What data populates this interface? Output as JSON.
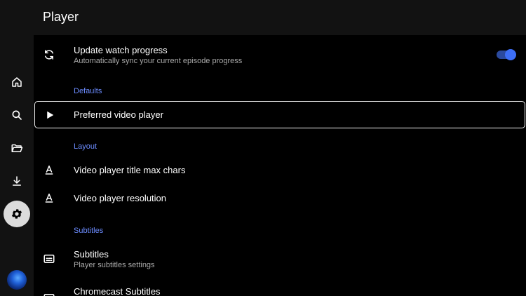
{
  "header": {
    "title": "Player"
  },
  "nav": [
    {
      "name": "home",
      "icon": "home-icon",
      "active": false
    },
    {
      "name": "search",
      "icon": "search-icon",
      "active": false
    },
    {
      "name": "library",
      "icon": "folder-open-icon",
      "active": false
    },
    {
      "name": "downloads",
      "icon": "download-icon",
      "active": false
    },
    {
      "name": "settings",
      "icon": "gear-icon",
      "active": true
    }
  ],
  "settings": {
    "watch_progress": {
      "title": "Update watch progress",
      "subtitle": "Automatically sync your current episode progress",
      "icon": "sync-icon",
      "enabled": true
    },
    "sections": {
      "defaults": "Defaults",
      "layout": "Layout",
      "subtitles": "Subtitles"
    },
    "preferred_player": {
      "title": "Preferred video player",
      "icon": "play-icon"
    },
    "title_max_chars": {
      "title": "Video player title max chars",
      "icon": "text-a-icon"
    },
    "resolution": {
      "title": "Video player resolution",
      "icon": "text-a-icon"
    },
    "subtitles": {
      "title": "Subtitles",
      "subtitle": "Player subtitles settings",
      "icon": "subtitles-icon"
    },
    "chromecast_subtitles": {
      "title": "Chromecast Subtitles",
      "icon": "subtitles-icon"
    }
  },
  "colors": {
    "accent": "#6c8cff",
    "toggle_on": "#3d6ef5",
    "rail_bg": "#121212",
    "content_bg": "#000000"
  }
}
